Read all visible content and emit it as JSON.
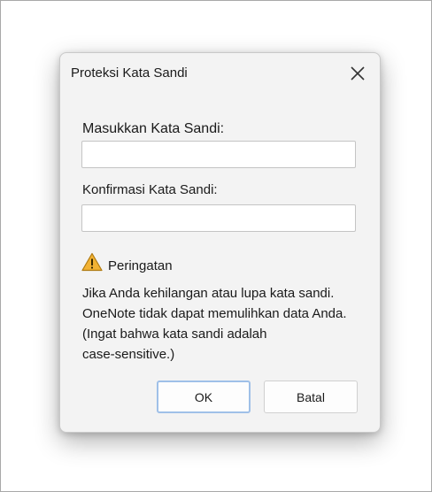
{
  "dialog": {
    "title": "Proteksi Kata Sandi",
    "close_icon": "close-icon"
  },
  "form": {
    "password_label": "Masukkan Kata Sandi:",
    "password_value": "",
    "confirm_label": "Konfirmasi Kata Sandi:",
    "confirm_value": ""
  },
  "warning": {
    "icon": "warning-icon",
    "icon_color": "#e8a200",
    "title": "Peringatan",
    "lines": [
      "Jika Anda kehilangan atau lupa kata sandi.",
      "OneNote tidak dapat memulihkan data Anda.",
      "(Ingat bahwa kata sandi adalah",
      "case-sensitive.)"
    ]
  },
  "buttons": {
    "ok_label": "OK",
    "cancel_label": "Batal"
  }
}
